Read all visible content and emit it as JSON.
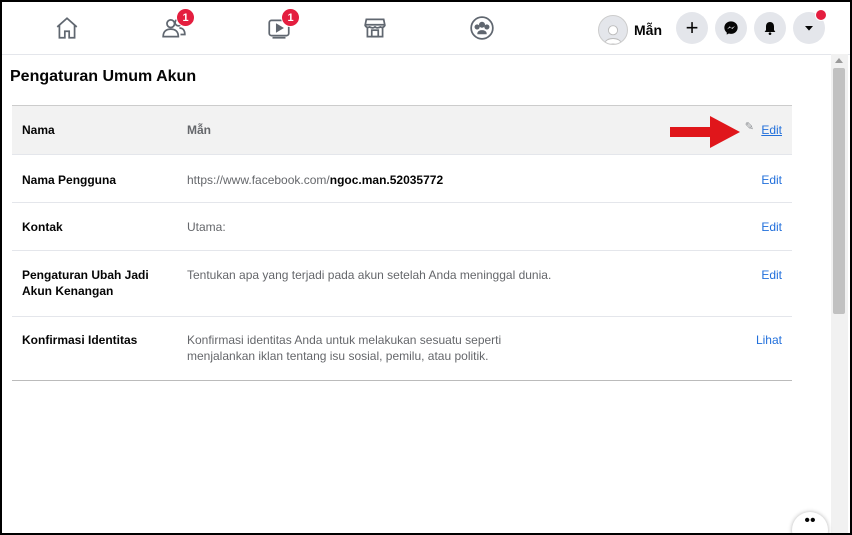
{
  "nav": {
    "home_icon": "home-icon",
    "friends_badge": "1",
    "watch_badge": "1",
    "marketplace_icon": "marketplace-icon",
    "groups_icon": "groups-icon"
  },
  "profile": {
    "name": "Mẫn"
  },
  "actions": {
    "create": "+",
    "messenger": "messenger-icon",
    "notifications": "bell-icon",
    "account": "caret-down-icon"
  },
  "page": {
    "title": "Pengaturan Umum Akun"
  },
  "rows": [
    {
      "label": "Nama",
      "value": "Mẫn",
      "action": "Edit"
    },
    {
      "label": "Nama Pengguna",
      "value_prefix": "https://www.facebook.com/",
      "value_bold": "ngoc.man.52035772",
      "action": "Edit"
    },
    {
      "label": "Kontak",
      "value": "Utama:",
      "action": "Edit"
    },
    {
      "label_line1": "Pengaturan Ubah Jadi",
      "label_line2": "Akun Kenangan",
      "value": "Tentukan apa yang terjadi pada akun setelah Anda meninggal dunia.",
      "action": "Edit"
    },
    {
      "label": "Konfirmasi Identitas",
      "value_line1": "Konfirmasi identitas Anda untuk melakukan sesuatu seperti",
      "value_line2": "menjalankan iklan tentang isu sosial, pemilu, atau politik.",
      "action": "Lihat"
    }
  ],
  "colors": {
    "accent": "#216fdb",
    "badge": "#e41e3f",
    "arrow": "#e0161b"
  }
}
